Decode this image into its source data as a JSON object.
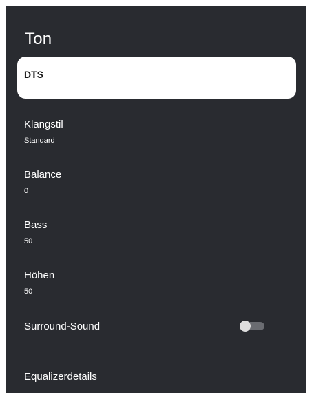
{
  "screen": {
    "title": "Ton",
    "selected_item": "DTS"
  },
  "menu": {
    "items": [
      {
        "label": "Klangstil",
        "value": "Standard"
      },
      {
        "label": "Balance",
        "value": "0"
      },
      {
        "label": "Bass",
        "value": "50"
      },
      {
        "label": "Höhen",
        "value": "50"
      },
      {
        "label": "Surround-Sound",
        "toggle_state": "off"
      },
      {
        "label": "Equalizerdetails"
      }
    ]
  },
  "colors": {
    "panel_background": "#292b30",
    "text": "#ffffff",
    "selection_background": "#ffffff",
    "toggle_track_off": "#6a6c71",
    "toggle_knob": "#dedede"
  }
}
